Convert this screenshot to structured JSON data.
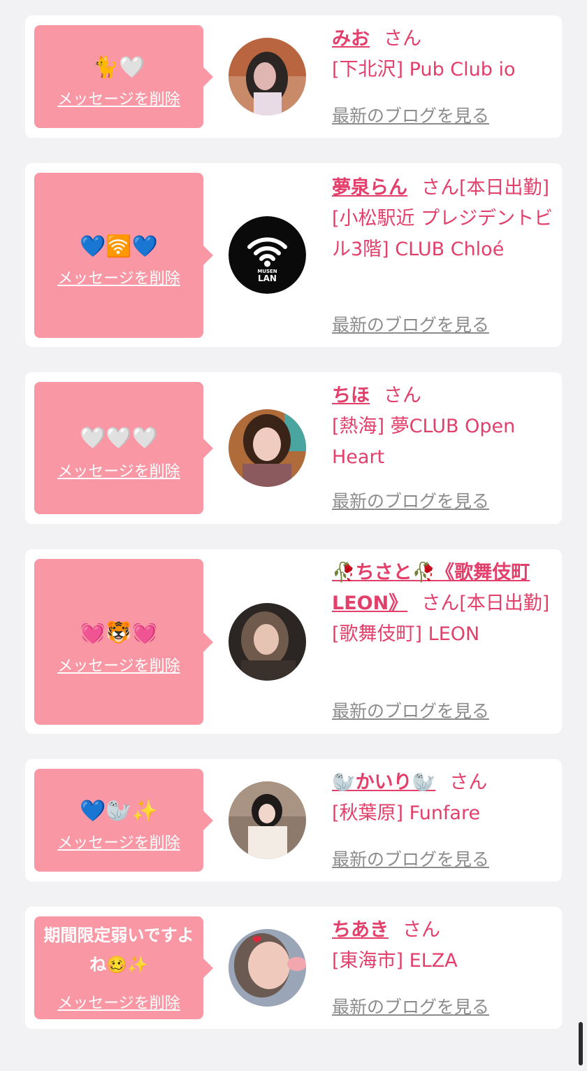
{
  "messages": [
    {
      "message": "🐈🤍",
      "delete_label": "メッセージを削除",
      "cast_name": "みお",
      "suffix": "さん",
      "shop": "[下北沢] Pub Club io",
      "blog_label": "最新のブログを見る"
    },
    {
      "message": "💙🛜💙",
      "delete_label": "メッセージを削除",
      "cast_name": "夢泉らん",
      "suffix": "さん[本日出勤]",
      "shop": "[小松駅近 プレジデントビル3階] CLUB Chloé",
      "blog_label": "最新のブログを見る",
      "avatar_text": [
        "MUSEN",
        "LAN"
      ]
    },
    {
      "message": "🤍🤍🤍",
      "delete_label": "メッセージを削除",
      "cast_name": "ちほ",
      "suffix": "さん",
      "shop": "[熱海] 夢CLUB Open Heart",
      "blog_label": "最新のブログを見る"
    },
    {
      "message": "💓🐯💓",
      "delete_label": "メッセージを削除",
      "cast_name": "🥀ちさと🥀《歌舞伎町LEON》",
      "suffix": "さん[本日出勤]",
      "shop": "[歌舞伎町] LEON",
      "blog_label": "最新のブログを見る"
    },
    {
      "message": "💙🦭✨",
      "delete_label": "メッセージを削除",
      "cast_name": "🦭かいり🦭",
      "suffix": "さん",
      "shop": "[秋葉原] Funfare",
      "blog_label": "最新のブログを見る"
    },
    {
      "message": "期間限定弱いですよね🥴✨",
      "delete_label": "メッセージを削除",
      "cast_name": "ちあき",
      "suffix": "さん",
      "shop": "[東海市] ELZA",
      "blog_label": "最新のブログを見る"
    }
  ],
  "colors": {
    "background": "#f2f2f4",
    "card": "#ffffff",
    "bubble": "#fa97a5",
    "accent_text": "#e23f6a",
    "link_gray": "#8c8c8c"
  }
}
